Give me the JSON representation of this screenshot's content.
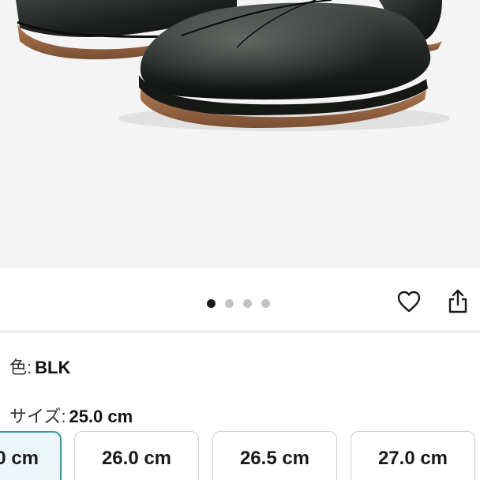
{
  "product_image": {
    "description_icon": "shoe-photo",
    "dots": {
      "count": 4,
      "active_index": 0
    }
  },
  "actions": {
    "like_icon": "heart-icon",
    "share_icon": "share-icon"
  },
  "options": {
    "color_label": "色:",
    "color_value": "BLK",
    "size_label": "サイズ:",
    "size_value": "25.0 cm"
  },
  "sizes": [
    {
      "label": "0 cm",
      "selected": true
    },
    {
      "label": "26.0 cm",
      "selected": false
    },
    {
      "label": "26.5 cm",
      "selected": false
    },
    {
      "label": "27.0 cm",
      "selected": false
    }
  ],
  "colors": {
    "selected_border": "#3a97a8",
    "selected_bg": "#eaf6f8",
    "dot_active": "#1a1a1a",
    "dot_inactive": "#c3c3c3"
  }
}
